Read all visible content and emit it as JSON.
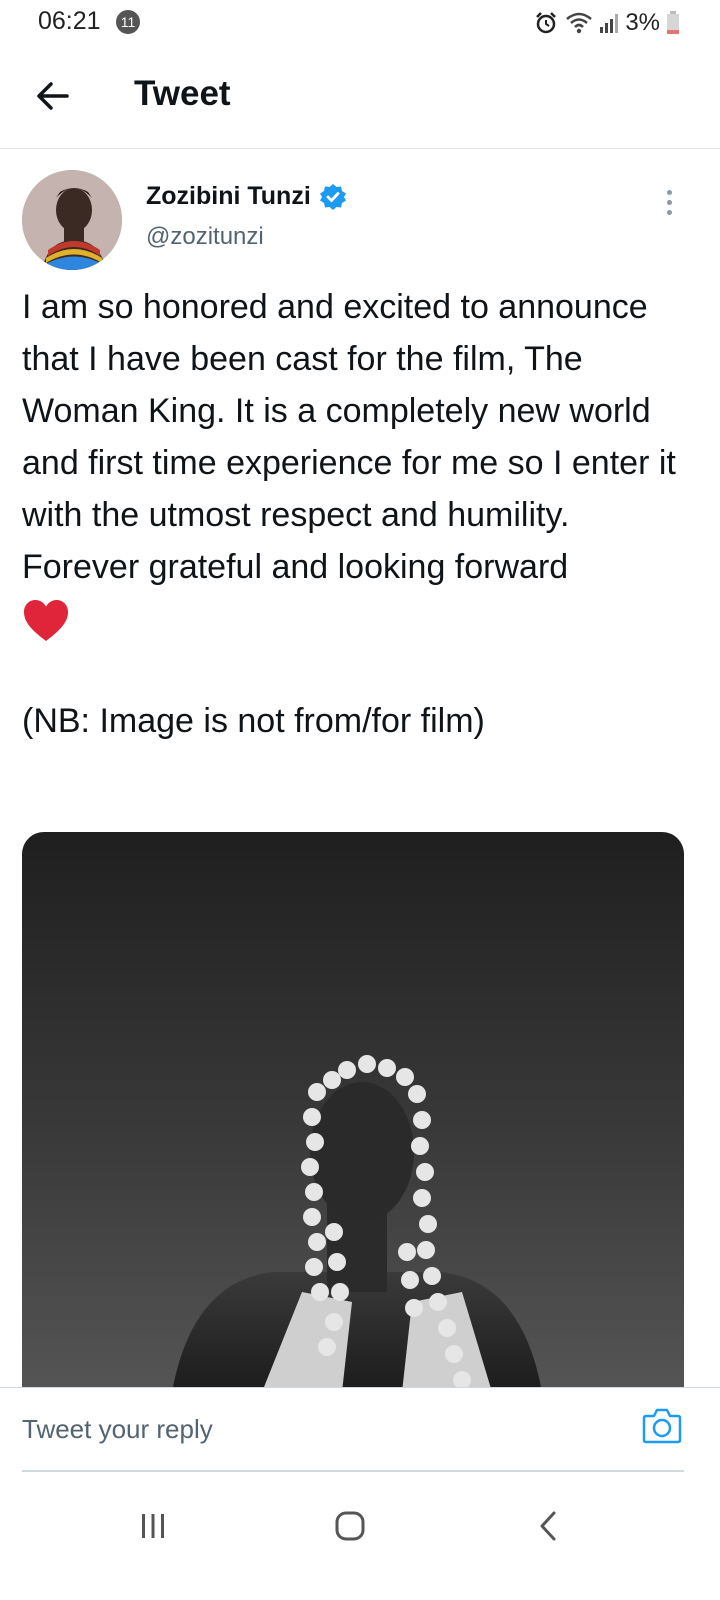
{
  "status_bar": {
    "time": "06:21",
    "notification_count": "11",
    "battery": "3%"
  },
  "header": {
    "title": "Tweet"
  },
  "tweet": {
    "author_name": "Zozibini Tunzi",
    "author_handle": "@zozitunzi",
    "text": "I am so honored and excited to announce that I have been cast for the film, The Woman King. It is a completely new world and first time experience for me so I enter it with the utmost respect and humility. Forever grateful and looking forward",
    "note": "(NB: Image is not from/for film)"
  },
  "reply": {
    "placeholder": "Tweet your reply"
  },
  "colors": {
    "verified": "#1d9bf0",
    "heart": "#e0243a",
    "camera": "#1d9bf0"
  },
  "icons": {
    "back": "arrow-left-icon",
    "verified": "verified-badge-icon",
    "more": "more-vertical-icon",
    "heart": "red-heart-icon",
    "camera": "camera-icon",
    "nav_recents": "recents-icon",
    "nav_home": "home-icon",
    "nav_back": "nav-back-icon"
  }
}
